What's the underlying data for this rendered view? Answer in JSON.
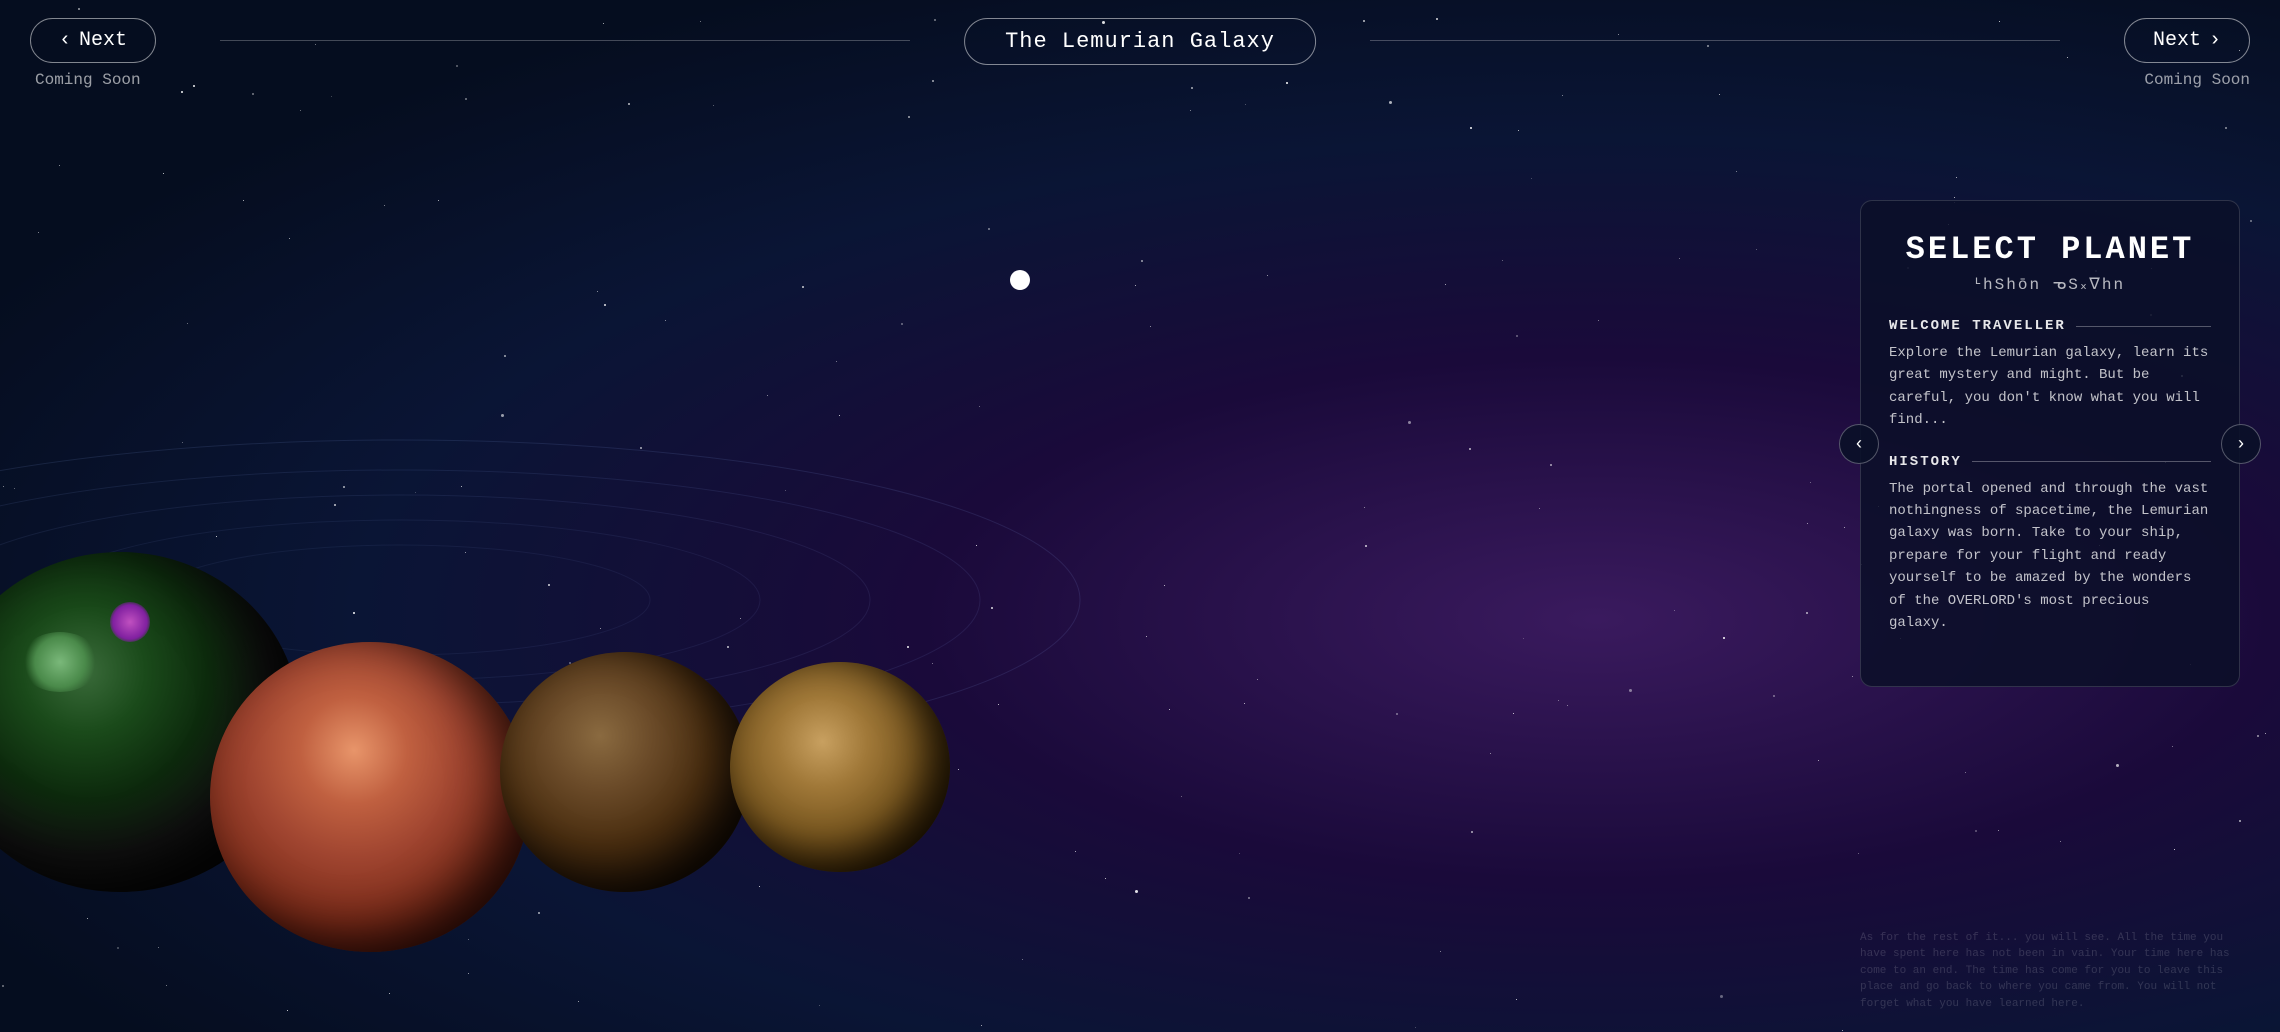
{
  "header": {
    "galaxy_title": "The Lemurian Galaxy",
    "nav_left": {
      "button_label": "Next",
      "arrow": "‹",
      "coming_soon": "Coming Soon"
    },
    "nav_right": {
      "button_label": "Next",
      "arrow": "›",
      "coming_soon": "Coming Soon"
    }
  },
  "panel": {
    "title": "SELECT PLANET",
    "subtitle": "ᒻhShōn ᓀS᙮ᐁhn",
    "welcome_section": {
      "label": "WELCOME TRAVELLER",
      "text": "Explore the Lemurian galaxy, learn its great mystery and might. But be careful, you don't know what you will find..."
    },
    "history_section": {
      "label": "HISTORY",
      "text": "The portal opened and through the vast nothingness of spacetime, the Lemurian galaxy was born. Take to your ship, prepare for your flight and ready yourself to be amazed by the wonders of the OVERLORD's most precious galaxy."
    },
    "nav_left_arrow": "‹",
    "nav_right_arrow": "›"
  },
  "bottom_text": "As for the rest of it... you will see. All the time you have spent here has not been in vain. Your time here has come to an end. The time has come for you to leave this place and go back to where you came from. You will not forget what you have learned here."
}
